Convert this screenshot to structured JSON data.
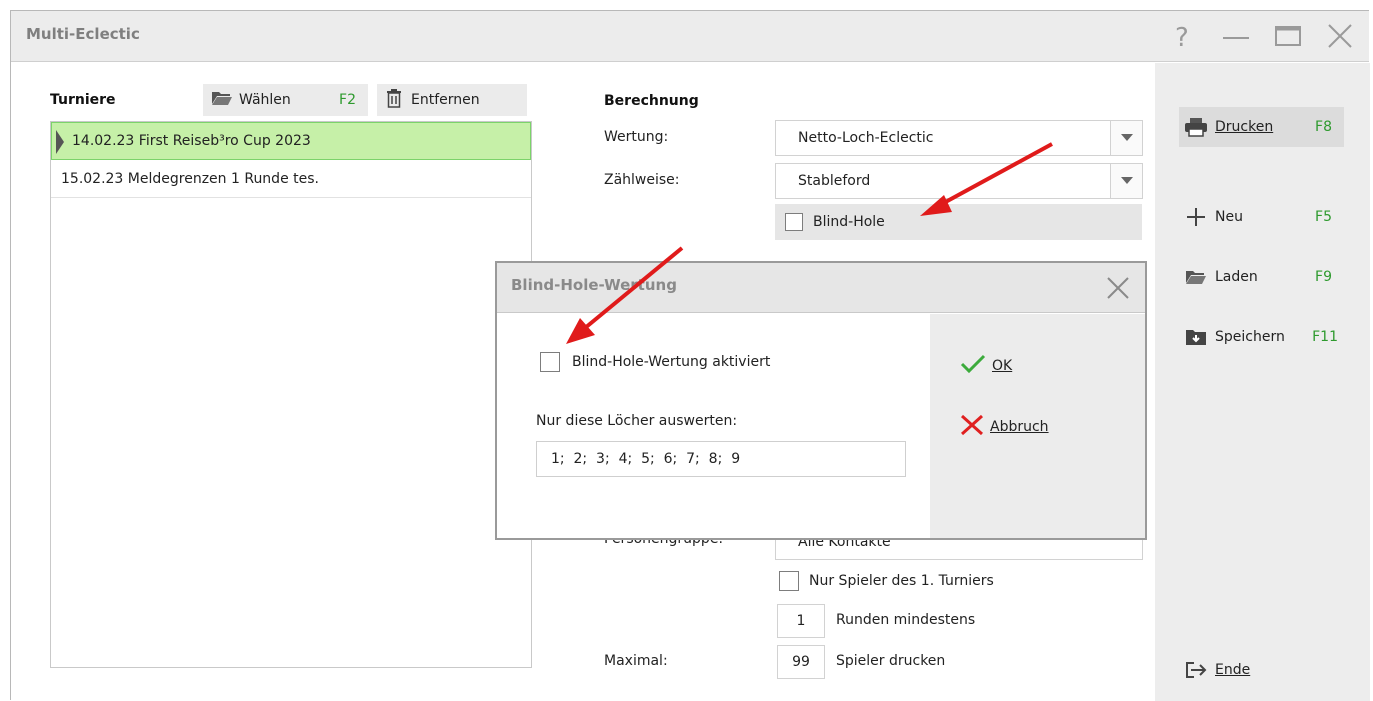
{
  "window": {
    "title": "Multi-Eclectic"
  },
  "tournaments": {
    "heading": "Turniere",
    "select_button": {
      "label": "Wählen",
      "key": "F2"
    },
    "remove_button": {
      "label": "Entfernen"
    },
    "items": [
      "14.02.23 First Reiseb³ro Cup 2023",
      "15.02.23 Meldegrenzen 1 Runde tes."
    ]
  },
  "calc": {
    "heading": "Berechnung",
    "scoring_label": "Wertung:",
    "scoring_value": "Netto-Loch-Eclectic",
    "counting_label": "Zählweise:",
    "counting_value": "Stableford",
    "blind_hole_label": "Blind-Hole",
    "person_group_label": "Personengruppe:",
    "person_group_value": "Alle Kontakte",
    "first_tournament_only_label": "Nur Spieler des 1. Turniers",
    "min_rounds_value": "1",
    "min_rounds_label": "Runden mindestens",
    "max_label": "Maximal:",
    "max_value": "99",
    "max_suffix": "Spieler drucken"
  },
  "sidebar": {
    "print": {
      "label": "Drucken",
      "key": "F8"
    },
    "new": {
      "label": "Neu",
      "key": "F5"
    },
    "load": {
      "label": "Laden",
      "key": "F9"
    },
    "save": {
      "label": "Speichern",
      "key": "F11"
    },
    "exit": {
      "label": "Ende"
    }
  },
  "dialog": {
    "title": "Blind-Hole-Wertung",
    "activate_label": "Blind-Hole-Wertung aktiviert",
    "holes_label": "Nur diese Löcher auswerten:",
    "holes_value": "1;  2;  3;  4;  5;  6;  7;  8;  9",
    "ok_label": "OK",
    "cancel_label": "Abbruch"
  },
  "colors": {
    "accent_green": "#2e9a2e",
    "selection": "#c6f0a8",
    "arrow_red": "#e01b1b"
  }
}
